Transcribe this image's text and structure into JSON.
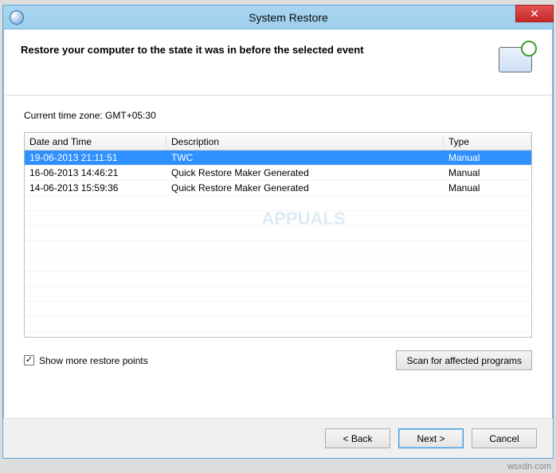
{
  "window": {
    "title": "System Restore"
  },
  "header": {
    "heading": "Restore your computer to the state it was in before the selected event"
  },
  "body": {
    "timezone_label": "Current time zone: GMT+05:30",
    "columns": {
      "date": "Date and Time",
      "description": "Description",
      "type": "Type"
    },
    "rows": [
      {
        "date": "19-06-2013 21:11:51",
        "description": "TWC",
        "type": "Manual",
        "selected": true
      },
      {
        "date": "16-06-2013 14:46:21",
        "description": "Quick Restore Maker Generated",
        "type": "Manual",
        "selected": false
      },
      {
        "date": "14-06-2013 15:59:36",
        "description": "Quick Restore Maker Generated",
        "type": "Manual",
        "selected": false
      }
    ],
    "show_more_label": "Show more restore points",
    "show_more_checked": true,
    "scan_button": "Scan for affected programs"
  },
  "footer": {
    "back": "< Back",
    "next": "Next >",
    "cancel": "Cancel"
  },
  "signature": "wsxdn.com"
}
